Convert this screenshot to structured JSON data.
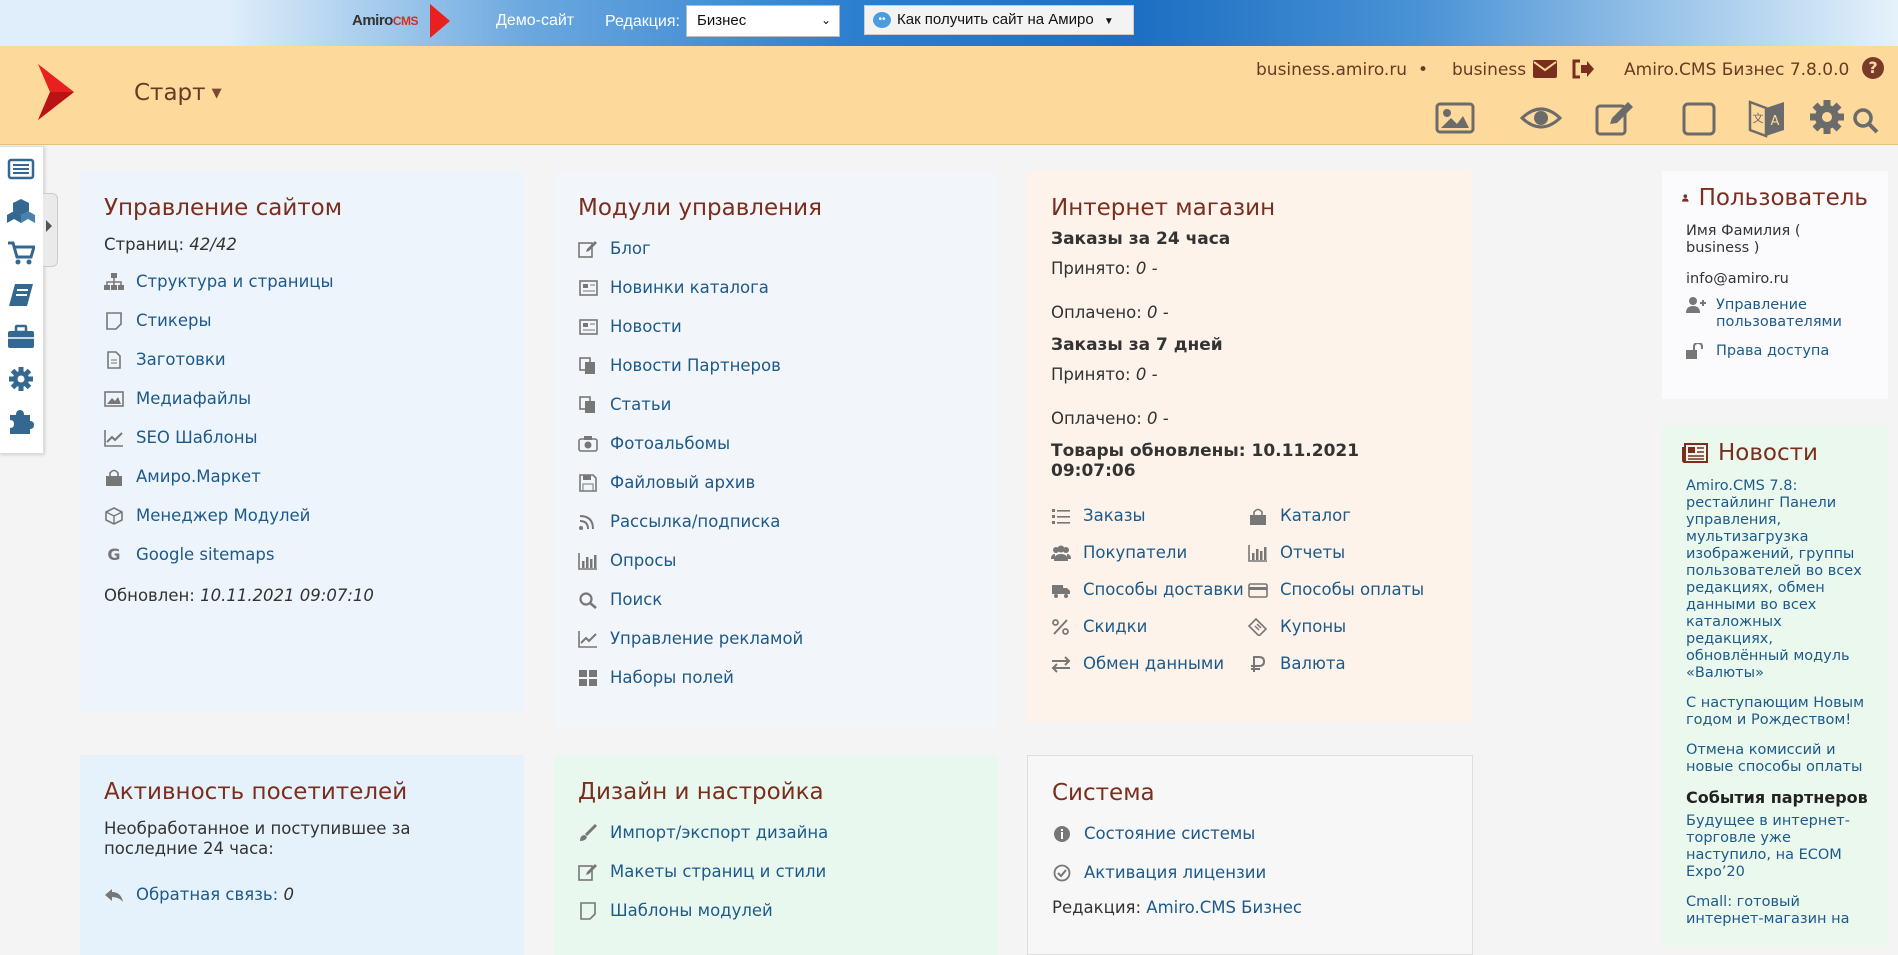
{
  "topbar": {
    "brand": "Amiro",
    "brand_suffix": "CMS",
    "demo_link": "Демо-сайт",
    "edition_label": "Редакция:",
    "edition_value": "Бизнес",
    "howto_button": "Как получить сайт на Амиро"
  },
  "header": {
    "start_label": "Старт",
    "site_domain": "business.amiro.ru",
    "separator": "•",
    "username": "business",
    "version": "Amiro.CMS Бизнес 7.8.0.0",
    "help_label": "?"
  },
  "site_card": {
    "title": "Управление сайтом",
    "pages_label": "Страниц:",
    "pages_value": "42/42",
    "items": [
      {
        "label": "Структура и страницы",
        "icon": "sitemap-icon"
      },
      {
        "label": "Стикеры",
        "icon": "sticker-icon"
      },
      {
        "label": "Заготовки",
        "icon": "file-icon"
      },
      {
        "label": "Медиафайлы",
        "icon": "image-icon"
      },
      {
        "label": "SEO Шаблоны",
        "icon": "chart-line-icon"
      },
      {
        "label": "Амиро.Маркет",
        "icon": "shopping-bag-icon"
      },
      {
        "label": "Менеджер Модулей",
        "icon": "cube-icon"
      },
      {
        "label": "Google sitemaps",
        "icon": "google-icon"
      }
    ],
    "updated_label": "Обновлен:",
    "updated_value": "10.11.2021 09:07:10"
  },
  "modules_card": {
    "title": "Модули управления",
    "items": [
      {
        "label": "Блог",
        "icon": "edit-icon"
      },
      {
        "label": "Новинки каталога",
        "icon": "newspaper-icon"
      },
      {
        "label": "Новости",
        "icon": "newspaper-icon"
      },
      {
        "label": "Новости Партнеров",
        "icon": "copy-icon"
      },
      {
        "label": "Статьи",
        "icon": "copy-icon"
      },
      {
        "label": "Фотоальбомы",
        "icon": "camera-icon"
      },
      {
        "label": "Файловый архив",
        "icon": "save-icon"
      },
      {
        "label": "Рассылка/подписка",
        "icon": "rss-icon"
      },
      {
        "label": "Опросы",
        "icon": "bar-chart-icon"
      },
      {
        "label": "Поиск",
        "icon": "search-icon"
      },
      {
        "label": "Управление рекламой",
        "icon": "chart-line-icon"
      },
      {
        "label": "Наборы полей",
        "icon": "grid-icon"
      }
    ]
  },
  "shop_card": {
    "title": "Интернет магазин",
    "orders_24h_label": "Заказы за 24 часа",
    "orders_7d_label": "Заказы за 7 дней",
    "accepted_label": "Принято:",
    "paid_label": "Оплачено:",
    "accepted_24h": "0 -",
    "paid_24h": "0 -",
    "accepted_7d": "0 -",
    "paid_7d": "0 -",
    "goods_updated": "Товары обновлены: 10.11.2021 09:07:06",
    "links": [
      {
        "label": "Заказы",
        "icon": "list-icon"
      },
      {
        "label": "Каталог",
        "icon": "shopping-bag-icon"
      },
      {
        "label": "Покупатели",
        "icon": "users-icon"
      },
      {
        "label": "Отчеты",
        "icon": "bar-chart-icon"
      },
      {
        "label": "Способы доставки",
        "icon": "truck-icon"
      },
      {
        "label": "Способы оплаты",
        "icon": "credit-card-icon"
      },
      {
        "label": "Скидки",
        "icon": "percent-icon"
      },
      {
        "label": "Купоны",
        "icon": "ticket-icon"
      },
      {
        "label": "Обмен данными",
        "icon": "exchange-icon"
      },
      {
        "label": "Валюта",
        "icon": "ruble-icon"
      }
    ]
  },
  "activity_card": {
    "title": "Активность посетителей",
    "description": "Необработанное и поступившее за последние 24 часа:",
    "feedback_label": "Обратная связь:",
    "feedback_value": "0"
  },
  "design_card": {
    "title": "Дизайн и настройка",
    "items": [
      {
        "label": "Импорт/экспорт дизайна",
        "icon": "paintbrush-icon"
      },
      {
        "label": "Макеты страниц и стили",
        "icon": "edit-icon"
      },
      {
        "label": "Шаблоны модулей",
        "icon": "sticker-icon"
      }
    ]
  },
  "system_card": {
    "title": "Система",
    "items": [
      {
        "label": "Состояние системы",
        "icon": "info-icon"
      },
      {
        "label": "Активация лицензии",
        "icon": "check-circle-icon"
      }
    ],
    "edition_label": "Редакция:",
    "edition_value": "Amiro.CMS Бизнес"
  },
  "user_card": {
    "title": "Пользователь",
    "name": "Имя Фамилия ( business )",
    "email": "info@amiro.ru",
    "manage_users": "Управление пользователями",
    "access_rights": "Права доступа"
  },
  "news_card": {
    "title": "Новости",
    "items": [
      "Amiro.CMS 7.8: рестайлинг Панели управления, мультизагрузка изображений, группы пользователей во всех редакциях, обмен данными во всех каталожных редакциях, обновлённый модуль «Валюты»",
      "С наступающим Новым годом и Рождеством!",
      "Отмена комиссий и новые способы оплаты"
    ],
    "partners_title": "События партнеров",
    "partner_items": [
      "Будущее в интернет-торговле уже наступило, на ECOM Expo’20",
      "Cmall: готовый интернет-магазин на"
    ]
  },
  "colors": {
    "header_bg": "#fdd99b",
    "title_color": "#7a2f1e",
    "link_color": "#1d5a8a",
    "brand_red": "#e82020"
  }
}
